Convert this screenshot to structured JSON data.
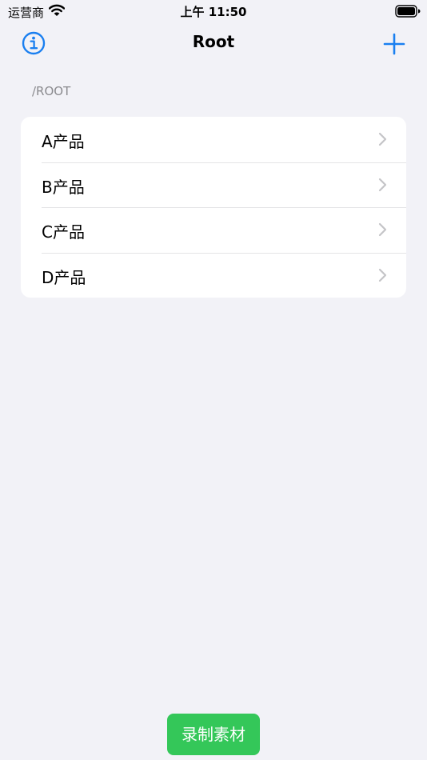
{
  "status_bar": {
    "carrier": "运营商",
    "time": "上午 11:50"
  },
  "nav": {
    "title": "Root",
    "left_icon": "info-icon",
    "right_icon": "plus-icon",
    "accent_color": "#1a7ff0"
  },
  "section": {
    "header": "/ROOT"
  },
  "list": {
    "items": [
      {
        "label": "A产品"
      },
      {
        "label": "B产品"
      },
      {
        "label": "C产品"
      },
      {
        "label": "D产品"
      }
    ]
  },
  "footer": {
    "record_label": "录制素材",
    "record_color": "#34c759"
  }
}
